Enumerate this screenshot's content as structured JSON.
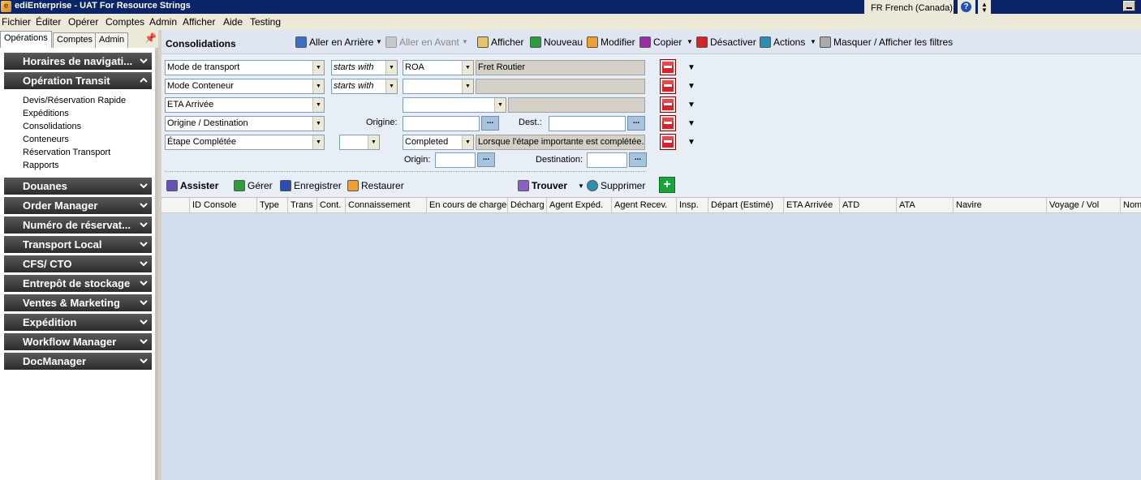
{
  "window": {
    "app_name": "ediEnterprise - UAT For Resource Strings",
    "language": "FR French (Canada)",
    "help_icon": "help-icon"
  },
  "menu": [
    "Fichier",
    "Éditer",
    "Opérer",
    "Comptes",
    "Admin",
    "Afficher",
    "Aide",
    "Testing"
  ],
  "left_tabs": [
    "Opérations",
    "Comptes",
    "Admin"
  ],
  "sidebar": {
    "sections": [
      {
        "label": "Horaires de navigati...",
        "expanded": false
      },
      {
        "label": "Opération Transit",
        "expanded": true
      },
      {
        "label": "Douanes",
        "expanded": false
      },
      {
        "label": "Order Manager",
        "expanded": false
      },
      {
        "label": "Numéro de réservat...",
        "expanded": false
      },
      {
        "label": "Transport Local",
        "expanded": false
      },
      {
        "label": "CFS/ CTO",
        "expanded": false
      },
      {
        "label": "Entrepôt de stockage",
        "expanded": false
      },
      {
        "label": "Ventes & Marketing",
        "expanded": false
      },
      {
        "label": "Expédition",
        "expanded": false
      },
      {
        "label": "Workflow Manager",
        "expanded": false
      },
      {
        "label": "DocManager",
        "expanded": false
      }
    ],
    "transit_items": [
      "Devis/Réservation Rapide",
      "Expéditions",
      "Consolidations",
      "Conteneurs",
      "Réservation Transport",
      "Rapports"
    ]
  },
  "toolbar": {
    "title": "Consolidations",
    "back": "Aller en Arrière",
    "forward": "Aller en Avant",
    "show": "Afficher",
    "new": "Nouveau",
    "edit": "Modifier",
    "copy": "Copier",
    "deactivate": "Désactiver",
    "actions": "Actions",
    "toggle_filters": "Masquer / Afficher les filtres"
  },
  "filters": {
    "row1": {
      "field": "Mode de transport",
      "operator": "starts with",
      "value": "ROA",
      "description": "Fret Routier"
    },
    "row2": {
      "field": "Mode Conteneur",
      "operator": "starts with",
      "value": "",
      "description": ""
    },
    "row3": {
      "field": "ETA Arrivée",
      "value": "",
      "description": ""
    },
    "row4": {
      "field": "Origine / Destination",
      "origin_label": "Origine:",
      "dest_label": "Dest.:",
      "ellipsis": "..."
    },
    "row5": {
      "field": "Étape Complétée",
      "operator": "",
      "value": "Completed",
      "description": "Lorsque l'étape importante est complétée."
    },
    "row6": {
      "origin_label": "Origin:",
      "destination_label": "Destination:"
    }
  },
  "actions": {
    "assist": "Assister",
    "manage": "Gérer",
    "save": "Enregistrer",
    "restore": "Restaurer",
    "find": "Trouver",
    "delete": "Supprimer",
    "add_icon": "+"
  },
  "grid": {
    "columns": [
      "ID Console",
      "Type",
      "Trans",
      "Cont.",
      "Connaissement",
      "En cours de charge",
      "Décharg",
      "Agent Expéd.",
      "Agent Recev.",
      "Insp.",
      "Départ (Estimé)",
      "ETA Arrivée",
      "ATD",
      "ATA",
      "Navire",
      "Voyage / Vol",
      "Nom"
    ]
  },
  "colors": {
    "title_bar": "#0a246a",
    "sidebar_section": "#3a3a3a",
    "grid_background": "#d2dfec",
    "delete_button": "#d2242a",
    "add_button": "#1aa33b"
  }
}
